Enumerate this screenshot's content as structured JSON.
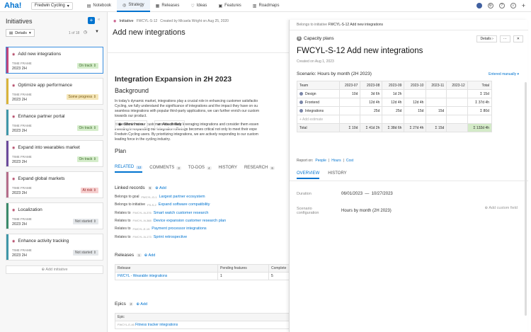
{
  "app": {
    "logo": "Aha!",
    "workspace": "Fredwin Cycling"
  },
  "nav": {
    "tabs": [
      {
        "label": "Notebook"
      },
      {
        "label": "Strategy"
      },
      {
        "label": "Releases"
      },
      {
        "label": "Ideas"
      },
      {
        "label": "Features"
      },
      {
        "label": "Roadmaps"
      }
    ],
    "active": "Strategy"
  },
  "left": {
    "title": "Initiatives",
    "details_label": "Details",
    "pager": "1 of 18",
    "add_initiative": "Add initiative",
    "cards": [
      {
        "title": "Add new integrations",
        "tf_label": "TIME FRAME",
        "tf": "2023 2H",
        "status": "On track",
        "bar": "#c2457a",
        "badge_bg": "#d5edcb",
        "badge_fg": "#3c6b2a"
      },
      {
        "title": "Optimize app performance",
        "tf_label": "TIME FRAME",
        "tf": "2023 2H",
        "status": "Some progress",
        "bar": "#d9b43a",
        "badge_bg": "#f5e6b8",
        "badge_fg": "#7a5a12"
      },
      {
        "title": "Enhance partner portal",
        "tf_label": "TIME FRAME",
        "tf": "2023 2H",
        "status": "On track",
        "bar": "#3e97a8",
        "badge_bg": "#d5edcb",
        "badge_fg": "#3c6b2a"
      },
      {
        "title": "Expand into wearables market",
        "tf_label": "TIME FRAME",
        "tf": "2023 2H",
        "status": "On track",
        "bar": "#6b4a9b",
        "badge_bg": "#d5edcb",
        "badge_fg": "#3c6b2a"
      },
      {
        "title": "Expand global markets",
        "tf_label": "TIME FRAME",
        "tf": "2023 2H",
        "status": "At risk",
        "bar": "#b56d8a",
        "badge_bg": "#f6cfcf",
        "badge_fg": "#9b2b2b"
      },
      {
        "title": "Localization",
        "tf_label": "TIME FRAME",
        "tf": "2023 2H",
        "status": "Not started",
        "bar": "#3a8a6a",
        "badge_bg": "#e4e7ea",
        "badge_fg": "#555"
      },
      {
        "title": "Enhance activity tracking",
        "tf_label": "TIME FRAME",
        "tf": "2023 2H",
        "status": "Not started",
        "bar": "#3e97a8",
        "badge_bg": "#e4e7ea",
        "badge_fg": "#555"
      }
    ]
  },
  "main": {
    "type": "Initiative",
    "id": "FWCYL-S-12",
    "created_by": "Created by Micaela Wright on Aug 25, 2020",
    "title": "Add new integrations",
    "doc_title": "Integration Expansion in 2H 2023",
    "background_heading": "Background",
    "para1": [
      "In today's dynamic market, integrations play a crucial role in enhancing customer satisfactio",
      "Cycling, we fully understand the significance of integrations and the impact they have on ou",
      "seamless integrations with popular third-party applications, we can further enrich our custom",
      "towards our product."
    ],
    "para2": [
      "It is evident that our customers are already leveraging integrations and consider them essen",
      "investing in expanding our integration offerings becomes critical not only to meet their expe",
      "Fredwin Cycling users. By prioritizing integrations, we are actively responding to our custom",
      "leading force in the cycling industry."
    ],
    "plan_heading": "Plan",
    "show_more": "Show more",
    "attach_files": "Attach files",
    "tabs": [
      {
        "label": "RELATED",
        "count": "12"
      },
      {
        "label": "COMMENTS",
        "count": "3"
      },
      {
        "label": "TO-DOS",
        "count": "4"
      },
      {
        "label": "HISTORY",
        "count": ""
      },
      {
        "label": "RESEARCH",
        "count": "6"
      }
    ],
    "linked_records": {
      "title": "Linked records",
      "count": "6",
      "add": "Add"
    },
    "records": [
      {
        "prefix": "Belongs to goal",
        "id": "FWCYL-G-1",
        "link": "Largest partner ecosystem"
      },
      {
        "prefix": "Belongs to initiative",
        "id": "FS-S-2",
        "link": "Expand software compatibility"
      },
      {
        "prefix": "Relates to",
        "id": "FWCYL-N-376",
        "link": "Smart watch customer research"
      },
      {
        "prefix": "Relates to",
        "id": "FWCYL-N-388",
        "link": "Device expansion customer research plan"
      },
      {
        "prefix": "Relates to",
        "id": "FWCYL-E-19",
        "link": "Payment processor integrations"
      },
      {
        "prefix": "Relates to",
        "id": "FWCYL-N-173",
        "link": "Sprint retrospective"
      }
    ],
    "releases": {
      "title": "Releases",
      "count": "1",
      "add": "Add",
      "headers": [
        "Release",
        "Pending features",
        "Complete"
      ],
      "rows": [
        [
          "FWCYL - Wearable integrations",
          "1",
          "5"
        ]
      ]
    },
    "epics": {
      "title": "Epics",
      "count": "2",
      "add": "Add",
      "header": "Epic",
      "rows": [
        {
          "id": "FWCYL-E-46",
          "name": "Fitness tracker integrations"
        }
      ]
    }
  },
  "panel": {
    "crumb_prefix": "Belongs to initiative",
    "crumb_value": "FWCYL-S-12 Add new integrations",
    "section": "Capacity plans",
    "details_btn": "Details",
    "more_btn": "···",
    "close_btn": "✕",
    "title": "FWCYL-S-12 Add new integrations",
    "created": "Created on Aug 1, 2023",
    "scenario": "Scenario: Hours by month (2H 2023)",
    "entered": "Entered manually",
    "columns": [
      "Team",
      "2023-07",
      "2023-08",
      "2023-09",
      "2023-10",
      "2023-11",
      "2023-12",
      "Total"
    ],
    "rows": [
      {
        "team": "Design",
        "values": [
          "10d",
          "3d 6h",
          "1d 2h",
          "",
          "",
          ""
        ],
        "total": "Σ 15d"
      },
      {
        "team": "Frontend",
        "values": [
          "",
          "12d 4h",
          "12d 4h",
          "12d 4h",
          "",
          ""
        ],
        "total": "Σ 37d 4h"
      },
      {
        "team": "Integrations",
        "values": [
          "",
          "25d",
          "25d",
          "15d",
          "15d",
          ""
        ],
        "total": "Σ 80d"
      }
    ],
    "add_estimate": "+ Add estimate",
    "total_row": {
      "label": "Total",
      "values": [
        "Σ 10d",
        "Σ 41d 2h",
        "Σ 38d 6h",
        "Σ 27d 4h",
        "Σ 15d",
        ""
      ],
      "total": "Σ 132d 4h"
    },
    "report_on": "Report on:",
    "report_links": [
      "People",
      "Hours",
      "Cost"
    ],
    "tabs": [
      "OVERVIEW",
      "HISTORY"
    ],
    "duration_label": "Duration",
    "duration_start": "06/01/2023",
    "duration_sep": "—",
    "duration_end": "10/27/2023",
    "scenario_label_1": "Scenario",
    "scenario_label_2": "configuration",
    "scenario_value": "Hours by month (2H 2023)",
    "add_custom": "Add custom field"
  }
}
